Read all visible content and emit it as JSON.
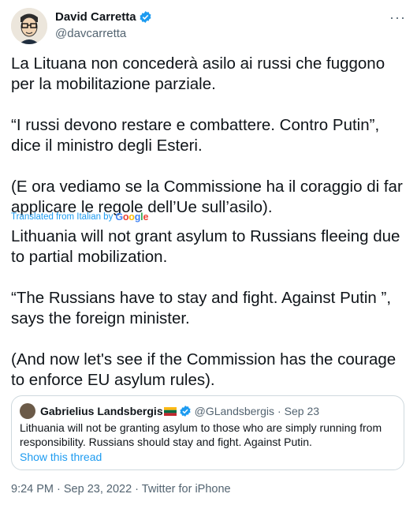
{
  "author": {
    "name": "David Carretta",
    "handle": "@davcarretta"
  },
  "menu_glyph": "···",
  "original_text": [
    "La Lituana non concederà asilo ai russi che fuggono per la mobilitazione parziale.",
    "“I russi devono restare e combattere. Contro Putin”, dice il ministro degli Esteri.",
    "(E ora vediamo se la Commissione ha il coraggio di far applicare le regole dell’Ue sull’asilo)."
  ],
  "translation_note": {
    "prefix": "Translated from Italian by",
    "brand": "Google"
  },
  "translated_text": [
    "Lithuania will not grant asylum to Russians fleeing due to partial mobilization.",
    "“The Russians have to stay and fight. Against Putin ”, says the foreign minister.",
    "(And now let's see if the Commission has the courage to enforce EU asylum rules)."
  ],
  "quoted_tweet": {
    "name": "Gabrielius Landsbergis",
    "handle": "@GLandsbergis",
    "separator": "·",
    "date": "Sep 23",
    "text": "Lithuania will not be granting asylum to those who are simply running from responsibility. Russians should stay and fight. Against Putin.",
    "show_thread": "Show this thread"
  },
  "meta": "9:24 PM · Sep 23, 2022 · Twitter for iPhone",
  "colors": {
    "accent": "#1d9bf0",
    "secondary_text": "#536471",
    "border": "#cfd9de"
  }
}
